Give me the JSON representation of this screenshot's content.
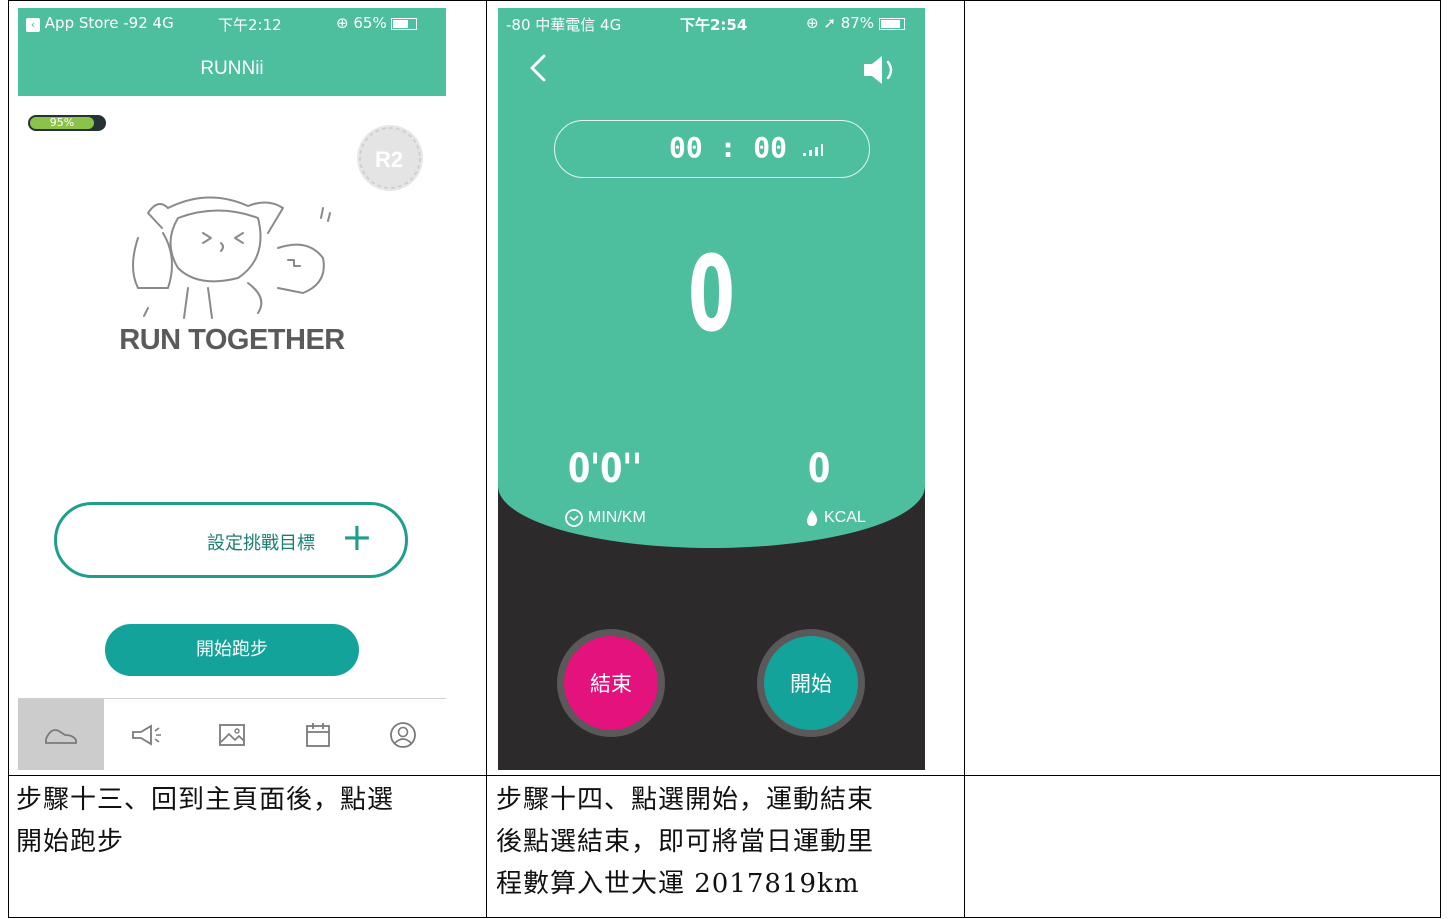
{
  "phone1": {
    "status": {
      "left": "App Store  -92  4G",
      "time": "下午2:12",
      "battery": "65%"
    },
    "title": "RUNNii",
    "battery_badge": "95%",
    "slogan": "RUN TOGETHER",
    "goal_button": "設定挑戰目標",
    "goal_plus": "+",
    "start_button": "開始跑步",
    "tabs": [
      "run-icon",
      "megaphone-icon",
      "image-icon",
      "calendar-icon",
      "profile-icon"
    ]
  },
  "phone2": {
    "status": {
      "left": "-80 中華電信  4G",
      "time": "下午2:54",
      "battery": "87%"
    },
    "back": "‹",
    "timer": "00 : 00",
    "distance": "0",
    "pace_value": "0'0''",
    "pace_label": "MIN/KM",
    "kcal_value": "0",
    "kcal_label": "KCAL",
    "end_button": "結束",
    "start_button": "開始",
    "accent_green": "#4dbf9f",
    "end_color": "#e3127c",
    "start_color": "#14a39a"
  },
  "captions": {
    "step13_line1": "步驟十三、回到主頁面後，點選",
    "step13_line2": "開始跑步",
    "step14_line1": "步驟十四、點選開始，運動結束",
    "step14_line2": "後點選結束，即可將當日運動里",
    "step14_line3": "程數算入世大運 2017819km"
  }
}
